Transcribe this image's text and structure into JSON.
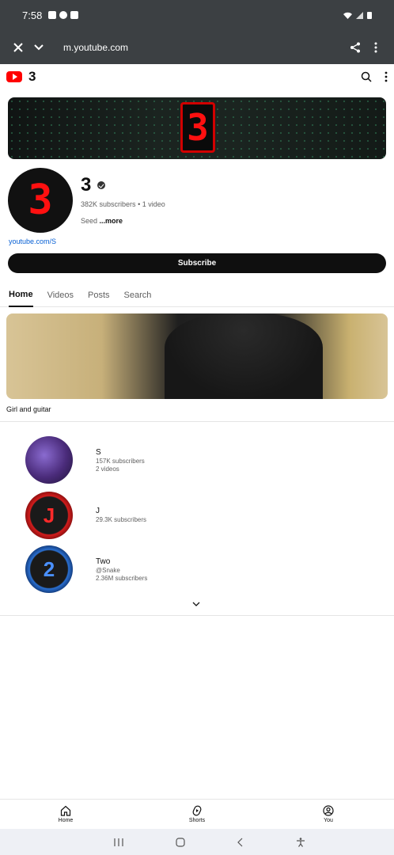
{
  "status_bar": {
    "time": "7:58"
  },
  "browser": {
    "url": "m.youtube.com"
  },
  "header": {
    "channel_name": "3"
  },
  "channel": {
    "title": "3",
    "subscribers": "382K subscribers",
    "videos": "1 video",
    "description": "Seed ",
    "more": "...more",
    "link": "youtube.com/S",
    "subscribe_label": "Subscribe"
  },
  "tabs": [
    {
      "label": "Home"
    },
    {
      "label": "Videos"
    },
    {
      "label": "Posts"
    },
    {
      "label": "Search"
    }
  ],
  "featured_video": {
    "title": "Girl and guitar"
  },
  "related_channels": [
    {
      "name": "S",
      "lines": [
        "157K subscribers",
        "2 videos"
      ],
      "avatar_glyph": "",
      "color": "#5a3a8a"
    },
    {
      "name": "J",
      "lines": [
        "29.3K subscribers"
      ],
      "avatar_glyph": "J",
      "color": "#d41c1c"
    },
    {
      "name": "Two",
      "lines": [
        "@Snake",
        "2.36M subscribers"
      ],
      "avatar_glyph": "2",
      "color": "#2a6fd0"
    }
  ],
  "bottom_nav": [
    {
      "label": "Home",
      "icon": "home-icon"
    },
    {
      "label": "Shorts",
      "icon": "shorts-icon"
    },
    {
      "label": "You",
      "icon": "you-icon"
    }
  ],
  "colors": {
    "brand_red": "#ff0000",
    "link": "#065fd4"
  }
}
